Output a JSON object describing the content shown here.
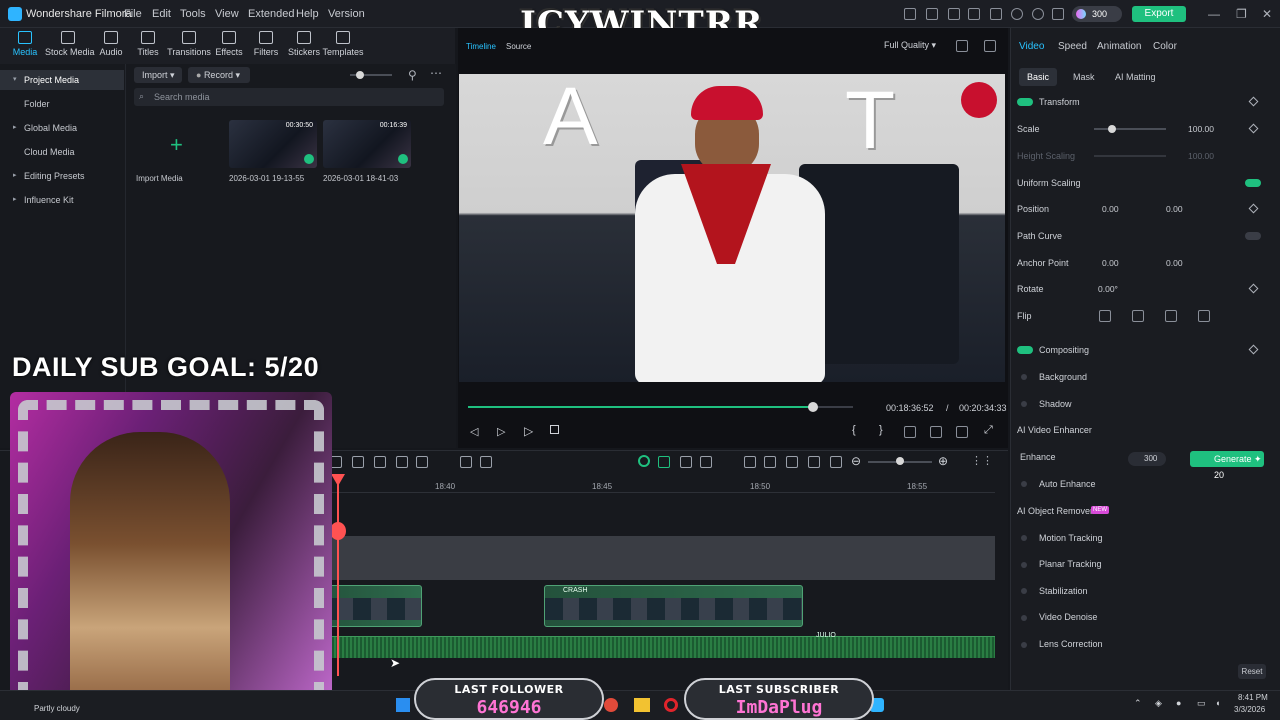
{
  "titlebar": {
    "app_name": "Wondershare Filmora",
    "menus": [
      "File",
      "Edit",
      "Tools",
      "View",
      "Extended",
      "Help",
      "Version"
    ],
    "stream_title": "ICYWINTRR",
    "credits": "300",
    "export_label": "Export",
    "quality": "Full Quality"
  },
  "toolbar": {
    "tools": [
      "Media",
      "Stock Media",
      "Audio",
      "Titles",
      "Transitions",
      "Effects",
      "Filters",
      "Stickers",
      "Templates"
    ]
  },
  "leftnav": {
    "items": [
      "Project Media",
      "Folder",
      "Global Media",
      "Cloud Media",
      "Editing Presets",
      "Influence Kit"
    ]
  },
  "media": {
    "import_label": "Import",
    "record_label": "Record",
    "search_placeholder": "Search media",
    "import_media_label": "Import Media",
    "clips": [
      {
        "duration": "00:30:50",
        "name": "2026-03-01 19-13-55"
      },
      {
        "duration": "00:16:39",
        "name": "2026-03-01 18-41-03"
      }
    ]
  },
  "preview": {
    "tabs": [
      "Timeline",
      "Source"
    ],
    "current_time": "00:18:36:52",
    "separator": "/",
    "total_time": "00:20:34:33",
    "progress": 0.9,
    "letters": [
      "A",
      "T"
    ]
  },
  "overlay": {
    "sub_goal": "DAILY SUB GOAL: 5/20",
    "last_follower_label": "LAST FOLLOWER",
    "last_follower_value": "646946",
    "last_subscriber_label": "LAST SUBSCRIBER",
    "last_subscriber_value": "ImDaPlug"
  },
  "timeline": {
    "ruler": [
      "18:40",
      "18:45",
      "18:50",
      "18:55"
    ],
    "clip_name": "CRASH",
    "audio_name": "JULIO"
  },
  "properties": {
    "tabs": [
      "Video",
      "Speed",
      "Animation",
      "Color"
    ],
    "subtabs": [
      "Basic",
      "Mask",
      "AI Matting"
    ],
    "transform_label": "Transform",
    "scale_label": "Scale",
    "scale_value": "100.00",
    "height_scaling_label": "Height Scaling",
    "height_scaling_value": "100.00",
    "uniform_scaling_label": "Uniform Scaling",
    "position_label": "Position",
    "pos_x": "0.00",
    "pos_y": "0.00",
    "path_curve_label": "Path Curve",
    "anchor_label": "Anchor Point",
    "anchor_x": "0.00",
    "anchor_y": "0.00",
    "rotate_label": "Rotate",
    "rotate_value": "0.00°",
    "flip_label": "Flip",
    "compositing_label": "Compositing",
    "background_label": "Background",
    "shadow_label": "Shadow",
    "ai_enhancer_label": "AI Video Enhancer",
    "enhance_label": "Enhance",
    "enhance_credits": "300",
    "generate_label": "Generate",
    "generate_cost": "20",
    "auto_enhance_label": "Auto Enhance",
    "ai_remover_label": "AI Object Remover",
    "new_badge": "NEW",
    "motion_tracking_label": "Motion Tracking",
    "planar_tracking_label": "Planar Tracking",
    "stabilization_label": "Stabilization",
    "video_denoise_label": "Video Denoise",
    "lens_correction_label": "Lens Correction",
    "reset_label": "Reset"
  },
  "taskbar": {
    "weather": "Partly cloudy",
    "time": "8:41 PM",
    "date": "3/3/2026"
  },
  "colors": {
    "accent": "#29c3ff",
    "green": "#1fc07f",
    "playhead": "#ff5252"
  }
}
